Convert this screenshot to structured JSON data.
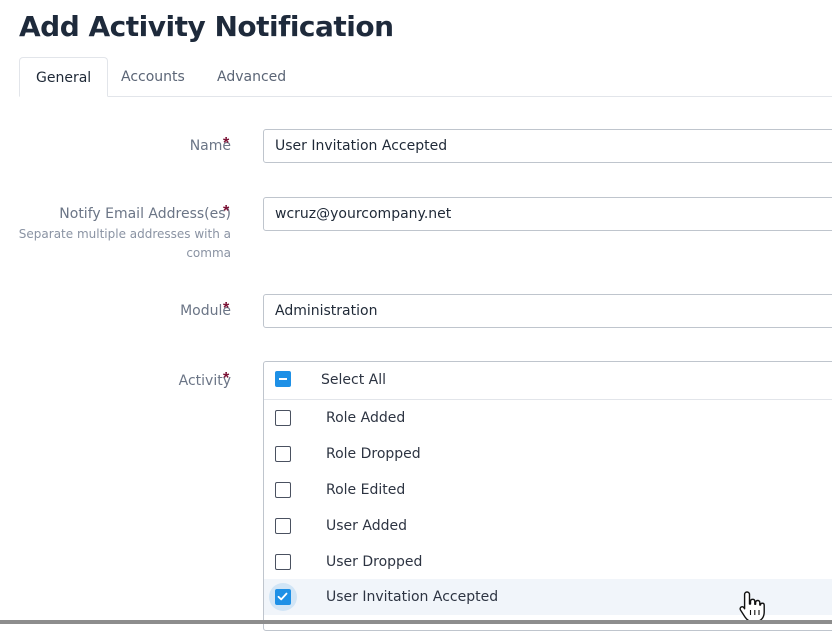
{
  "page": {
    "title": "Add Activity Notification"
  },
  "tabs": [
    {
      "label": "General",
      "active": true
    },
    {
      "label": "Accounts",
      "active": false
    },
    {
      "label": "Advanced",
      "active": false
    }
  ],
  "form": {
    "required_mark": "*",
    "name": {
      "label": "Name",
      "value": "User Invitation Accepted"
    },
    "email": {
      "label": "Notify Email Address(es)",
      "hint": "Separate multiple addresses with a comma",
      "value": "wcruz@yourcompany.net"
    },
    "module": {
      "label": "Module",
      "value": "Administration"
    },
    "activity": {
      "label": "Activity",
      "select_all_label": "Select All",
      "select_all_state": "indeterminate",
      "items": [
        {
          "label": "Role Added",
          "checked": false
        },
        {
          "label": "Role Dropped",
          "checked": false
        },
        {
          "label": "Role Edited",
          "checked": false
        },
        {
          "label": "User Added",
          "checked": false
        },
        {
          "label": "User Dropped",
          "checked": false
        },
        {
          "label": "User Invitation Accepted",
          "checked": true
        }
      ]
    }
  },
  "colors": {
    "accent": "#1e90e6",
    "required": "#7a1033",
    "title": "#1e2a3b"
  },
  "icons": {
    "cursor": "hand-pointer-icon",
    "check": "check-icon",
    "minus": "minus-icon"
  }
}
